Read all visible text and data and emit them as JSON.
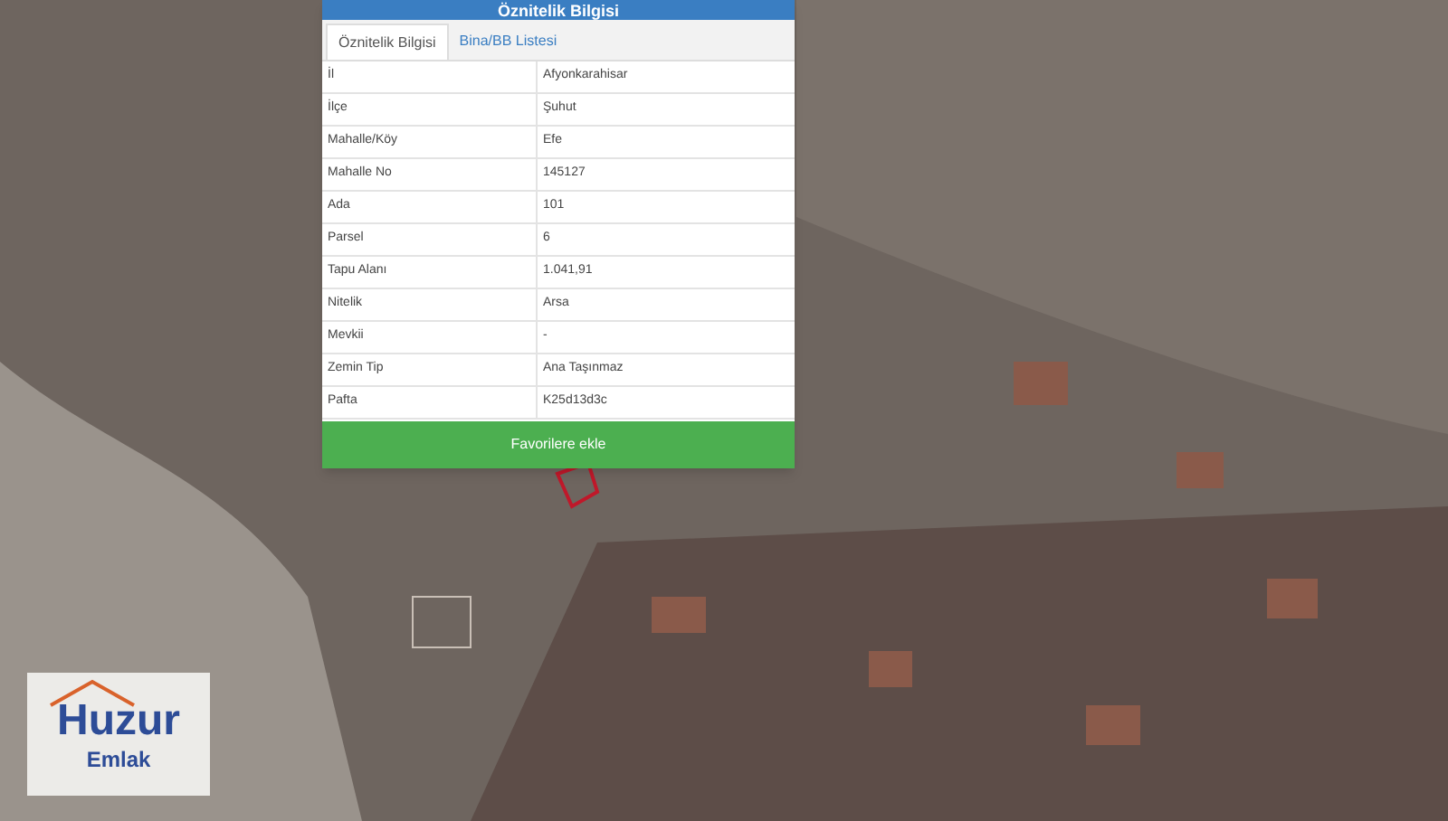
{
  "panel": {
    "title": "Öznitelik Bilgisi",
    "tabs": [
      {
        "label": "Öznitelik Bilgisi",
        "selected": true
      },
      {
        "label": "Bina/BB Listesi",
        "selected": false
      }
    ],
    "rows": [
      {
        "label": "İl",
        "value": "Afyonkarahisar"
      },
      {
        "label": "İlçe",
        "value": "Şuhut"
      },
      {
        "label": "Mahalle/Köy",
        "value": "Efe"
      },
      {
        "label": "Mahalle No",
        "value": "145127"
      },
      {
        "label": "Ada",
        "value": "101"
      },
      {
        "label": "Parsel",
        "value": "6"
      },
      {
        "label": "Tapu Alanı",
        "value": "1.041,91"
      },
      {
        "label": "Nitelik",
        "value": "Arsa"
      },
      {
        "label": "Mevkii",
        "value": "-"
      },
      {
        "label": "Zemin Tip",
        "value": "Ana Taşınmaz"
      },
      {
        "label": "Pafta",
        "value": "K25d13d3c"
      }
    ],
    "button": "Favorilere ekle"
  },
  "logo": {
    "name": "Huzur",
    "subtitle": "Emlak"
  }
}
